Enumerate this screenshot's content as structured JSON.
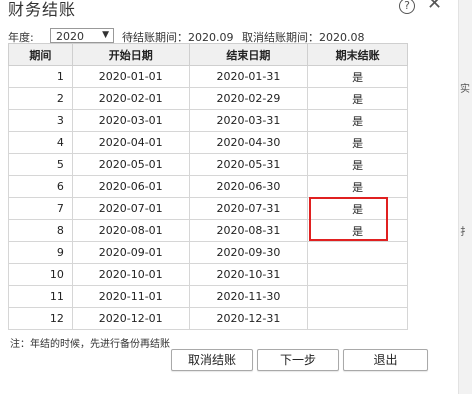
{
  "dialog": {
    "title": "财务结账",
    "help_icon": "?",
    "close_icon": "✕"
  },
  "toolbar": {
    "year_label": "年度:",
    "year_value": "2020",
    "pending_period": "待结账期间：2020.09",
    "cancelled_period": "取消结账期间：2020.08"
  },
  "table": {
    "headers": [
      "期间",
      "开始日期",
      "结束日期",
      "期末结账"
    ],
    "rows": [
      {
        "period": "1",
        "start": "2020-01-01",
        "end": "2020-01-31",
        "closed": "是"
      },
      {
        "period": "2",
        "start": "2020-02-01",
        "end": "2020-02-29",
        "closed": "是"
      },
      {
        "period": "3",
        "start": "2020-03-01",
        "end": "2020-03-31",
        "closed": "是"
      },
      {
        "period": "4",
        "start": "2020-04-01",
        "end": "2020-04-30",
        "closed": "是"
      },
      {
        "period": "5",
        "start": "2020-05-01",
        "end": "2020-05-31",
        "closed": "是"
      },
      {
        "period": "6",
        "start": "2020-06-01",
        "end": "2020-06-30",
        "closed": "是"
      },
      {
        "period": "7",
        "start": "2020-07-01",
        "end": "2020-07-31",
        "closed": "是"
      },
      {
        "period": "8",
        "start": "2020-08-01",
        "end": "2020-08-31",
        "closed": "是"
      },
      {
        "period": "9",
        "start": "2020-09-01",
        "end": "2020-09-30",
        "closed": ""
      },
      {
        "period": "10",
        "start": "2020-10-01",
        "end": "2020-10-31",
        "closed": ""
      },
      {
        "period": "11",
        "start": "2020-11-01",
        "end": "2020-11-30",
        "closed": ""
      },
      {
        "period": "12",
        "start": "2020-12-01",
        "end": "2020-12-31",
        "closed": ""
      }
    ]
  },
  "note": "注：年结的时候，先进行备份再结账",
  "buttons": {
    "cancel_close": "取消结账",
    "next_step": "下一步",
    "exit": "退出"
  },
  "edge_chars": [
    "实",
    "扌"
  ],
  "colors": {
    "highlight": "#e02020",
    "header_bg": "#f0f0f0"
  }
}
